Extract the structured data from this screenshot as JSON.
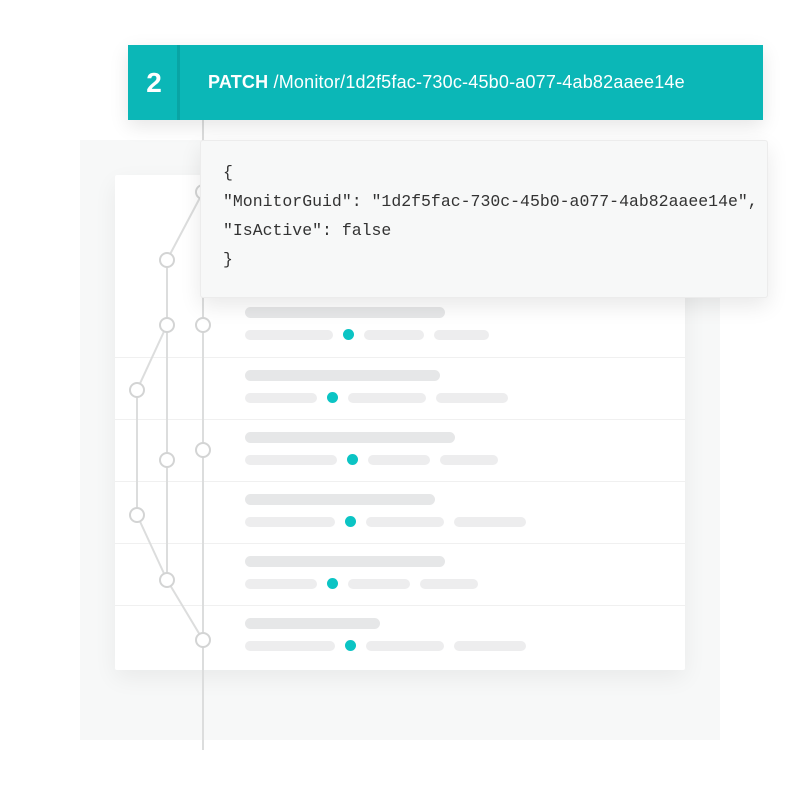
{
  "step": "2",
  "method": "PATCH",
  "path": " /Monitor/1d2f5fac-730c-45b0-a077-4ab82aaee14e",
  "code": "{\n\"MonitorGuid\": \"1d2f5fac-730c-45b0-a077-4ab82aaee14e\",\n\"IsActive\": false\n}",
  "rows": [
    {
      "topW": 200,
      "preW": 88,
      "aW": 60,
      "bW": 55
    },
    {
      "topW": 195,
      "preW": 72,
      "aW": 78,
      "bW": 72
    },
    {
      "topW": 210,
      "preW": 92,
      "aW": 62,
      "bW": 58
    },
    {
      "topW": 190,
      "preW": 90,
      "aW": 78,
      "bW": 72
    },
    {
      "topW": 200,
      "preW": 72,
      "aW": 62,
      "bW": 58
    },
    {
      "topW": 135,
      "preW": 90,
      "aW": 78,
      "bW": 72
    }
  ],
  "colors": {
    "accent": "#0bb7b7",
    "dot": "#0bc4c4"
  }
}
